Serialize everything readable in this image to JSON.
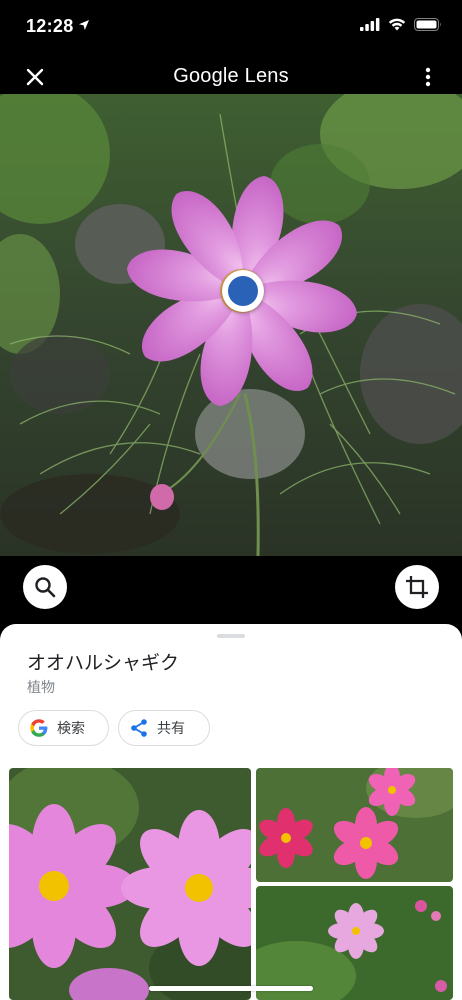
{
  "status": {
    "time": "12:28",
    "location_icon": "location-arrow-icon",
    "signal_icon": "signal-icon",
    "wifi_icon": "wifi-icon",
    "battery_icon": "battery-icon"
  },
  "header": {
    "title": "Google Lens",
    "close_icon": "close-icon",
    "more_icon": "more-vert-icon"
  },
  "actions": {
    "search_icon": "search-icon",
    "crop_icon": "crop-icon"
  },
  "result": {
    "title": "オオハルシャギク",
    "category": "植物",
    "chips": [
      {
        "label": "検索",
        "icon": "google-g-icon"
      },
      {
        "label": "共有",
        "icon": "share-icon"
      }
    ]
  },
  "colors": {
    "accent_blue": "#1a73e8",
    "selection_dot": "#2a62b8",
    "petal_pink": "#d98ad8",
    "background_dark": "#000000"
  }
}
